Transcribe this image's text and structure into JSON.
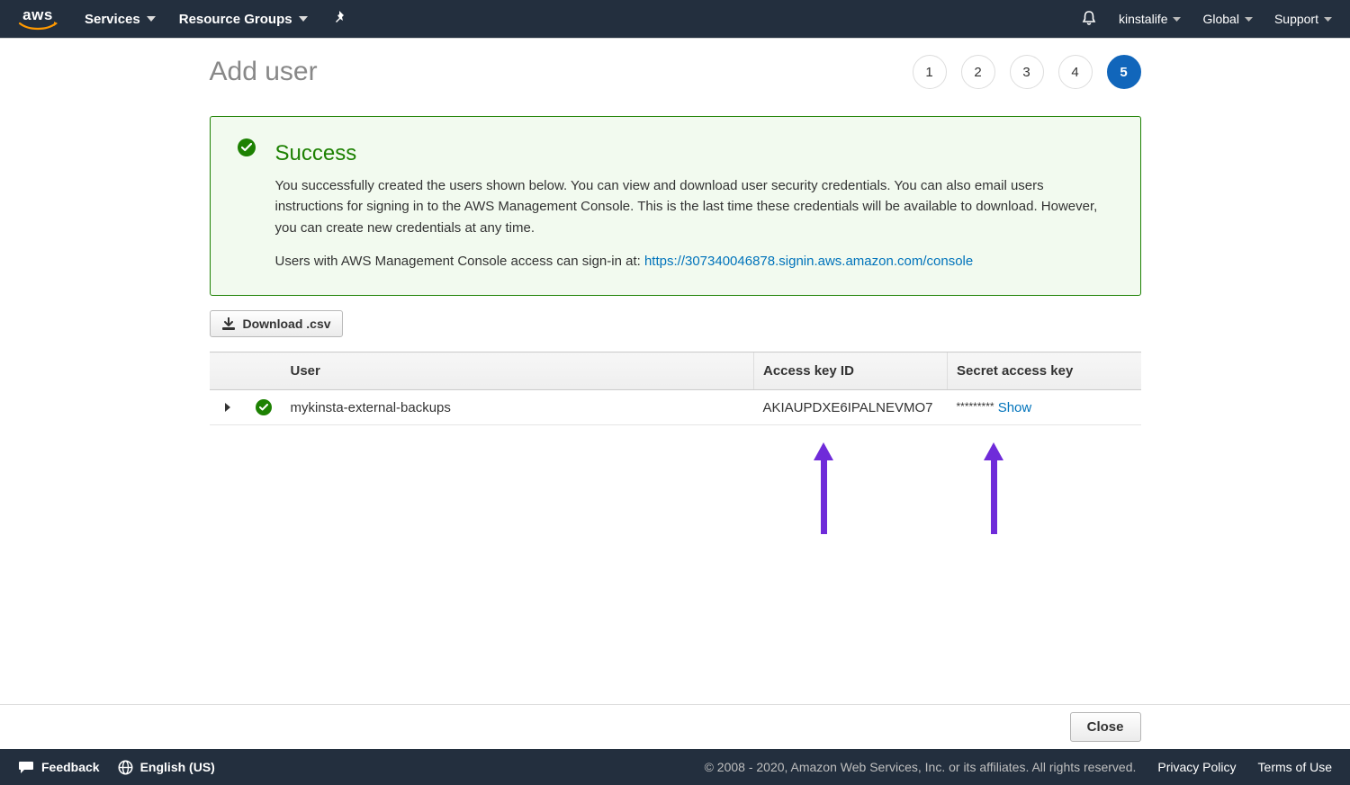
{
  "nav": {
    "logo": "aws",
    "services": "Services",
    "resource_groups": "Resource Groups",
    "account": "kinstalife",
    "region": "Global",
    "support": "Support"
  },
  "page": {
    "title": "Add user",
    "steps": [
      "1",
      "2",
      "3",
      "4",
      "5"
    ],
    "active_step_index": 4
  },
  "alert": {
    "title": "Success",
    "body1": "You successfully created the users shown below. You can view and download user security credentials. You can also email users instructions for signing in to the AWS Management Console. This is the last time these credentials will be available to download. However, you can create new credentials at any time.",
    "body2_prefix": "Users with AWS Management Console access can sign-in at: ",
    "signin_url": "https://307340046878.signin.aws.amazon.com/console"
  },
  "download_btn": "Download .csv",
  "table": {
    "headers": {
      "user": "User",
      "access_key": "Access key ID",
      "secret_key": "Secret access key"
    },
    "rows": [
      {
        "username": "mykinsta-external-backups",
        "access_key": "AKIAUPDXE6IPALNEVMO7",
        "secret_mask": "*********",
        "show_label": "Show"
      }
    ]
  },
  "actions": {
    "close": "Close"
  },
  "footer": {
    "feedback": "Feedback",
    "language": "English (US)",
    "copyright": "© 2008 - 2020, Amazon Web Services, Inc. or its affiliates. All rights reserved.",
    "privacy": "Privacy Policy",
    "terms": "Terms of Use"
  }
}
